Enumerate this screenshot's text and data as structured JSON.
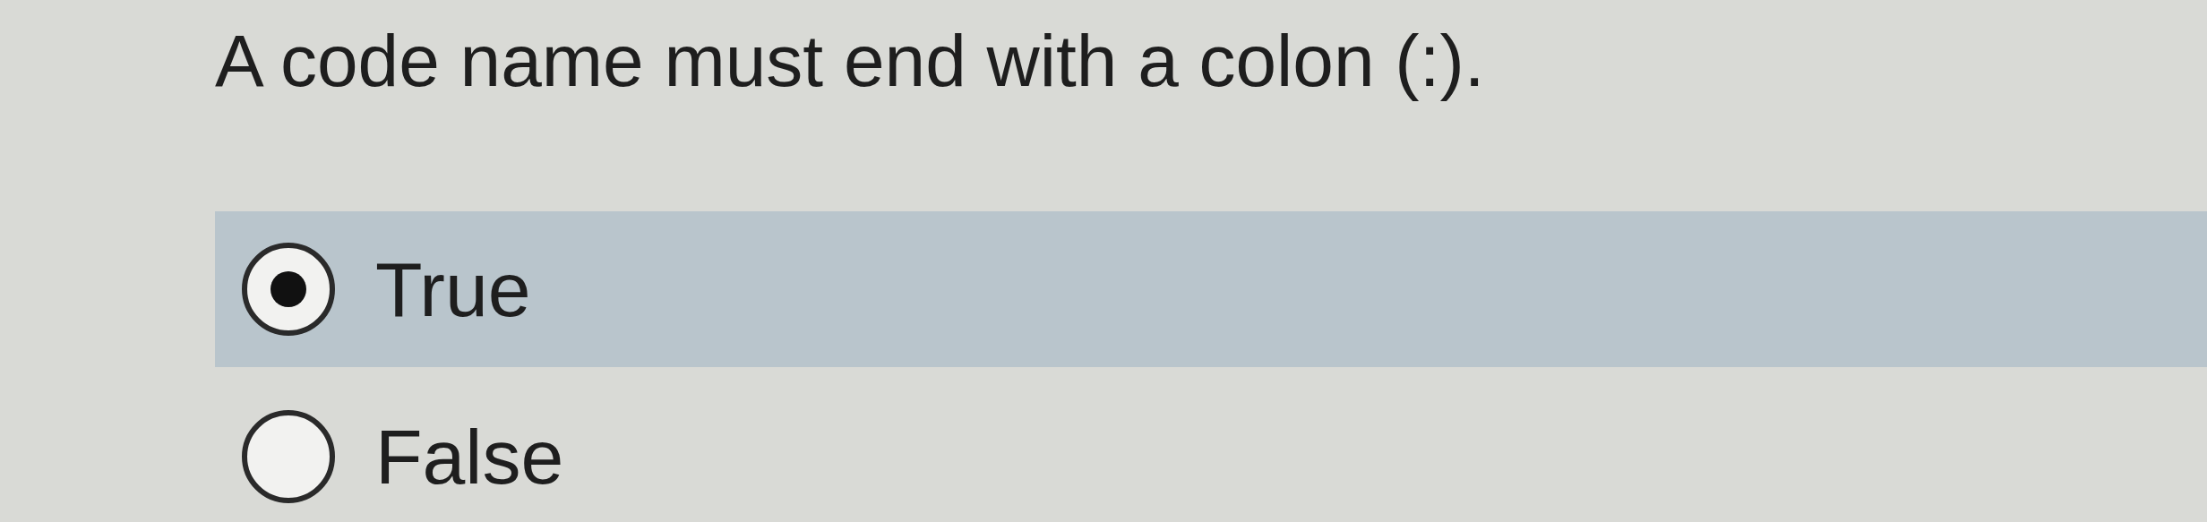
{
  "question": "A code name must end with a colon (:).",
  "options": [
    {
      "label": "True",
      "selected": true
    },
    {
      "label": "False",
      "selected": false
    }
  ]
}
